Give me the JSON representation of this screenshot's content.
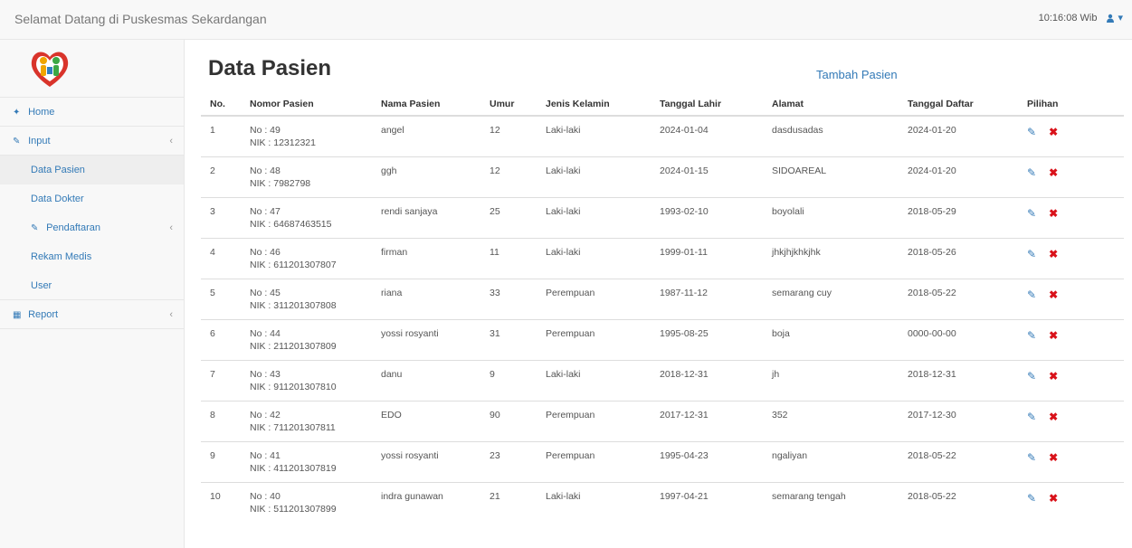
{
  "header": {
    "brand": "Selamat Datang di Puskesmas Sekardangan",
    "clock": "10:16:08 Wib",
    "user_icon": "user-icon",
    "caret": "▾"
  },
  "sidebar": {
    "items": [
      {
        "label": "Home",
        "icon": "home-icon",
        "glyph": "✦"
      },
      {
        "label": "Input",
        "icon": "edit-icon",
        "glyph": "✎",
        "chevron": "‹"
      },
      {
        "label": "Data Pasien"
      },
      {
        "label": "Data Dokter"
      },
      {
        "label": "Pendaftaran",
        "icon": "edit-icon",
        "glyph": "✎",
        "chevron": "‹"
      },
      {
        "label": "Rekam Medis"
      },
      {
        "label": "User"
      },
      {
        "label": "Report",
        "icon": "table-icon",
        "glyph": "▦",
        "chevron": "‹"
      }
    ]
  },
  "main": {
    "title": "Data Pasien",
    "add_link": "Tambah Pasien",
    "columns": [
      "No.",
      "Nomor Pasien",
      "Nama Pasien",
      "Umur",
      "Jenis Kelamin",
      "Tanggal Lahir",
      "Alamat",
      "Tanggal Daftar",
      "Pilihan"
    ],
    "rows": [
      {
        "no": "1",
        "nomor": "No : 49",
        "nik": "NIK : 12312321",
        "nama": "angel",
        "umur": "12",
        "jk": "Laki-laki",
        "lahir": "2024-01-04",
        "alamat": "dasdusadas",
        "daftar": "2024-01-20"
      },
      {
        "no": "2",
        "nomor": "No : 48",
        "nik": "NIK : 7982798",
        "nama": "ggh",
        "umur": "12",
        "jk": "Laki-laki",
        "lahir": "2024-01-15",
        "alamat": "SIDOAREAL",
        "daftar": "2024-01-20"
      },
      {
        "no": "3",
        "nomor": "No : 47",
        "nik": "NIK : 64687463515",
        "nama": "rendi sanjaya",
        "umur": "25",
        "jk": "Laki-laki",
        "lahir": "1993-02-10",
        "alamat": "boyolali",
        "daftar": "2018-05-29"
      },
      {
        "no": "4",
        "nomor": "No : 46",
        "nik": "NIK : 611201307807",
        "nama": "firman",
        "umur": "11",
        "jk": "Laki-laki",
        "lahir": "1999-01-11",
        "alamat": "jhkjhjkhkjhk",
        "daftar": "2018-05-26"
      },
      {
        "no": "5",
        "nomor": "No : 45",
        "nik": "NIK : 311201307808",
        "nama": "riana",
        "umur": "33",
        "jk": "Perempuan",
        "lahir": "1987-11-12",
        "alamat": "semarang cuy",
        "daftar": "2018-05-22"
      },
      {
        "no": "6",
        "nomor": "No : 44",
        "nik": "NIK : 211201307809",
        "nama": "yossi rosyanti",
        "umur": "31",
        "jk": "Perempuan",
        "lahir": "1995-08-25",
        "alamat": "boja",
        "daftar": "0000-00-00"
      },
      {
        "no": "7",
        "nomor": "No : 43",
        "nik": "NIK : 911201307810",
        "nama": "danu",
        "umur": "9",
        "jk": "Laki-laki",
        "lahir": "2018-12-31",
        "alamat": "jh",
        "daftar": "2018-12-31"
      },
      {
        "no": "8",
        "nomor": "No : 42",
        "nik": "NIK : 711201307811",
        "nama": "EDO",
        "umur": "90",
        "jk": "Perempuan",
        "lahir": "2017-12-31",
        "alamat": "352",
        "daftar": "2017-12-30"
      },
      {
        "no": "9",
        "nomor": "No : 41",
        "nik": "NIK : 411201307819",
        "nama": "yossi rosyanti",
        "umur": "23",
        "jk": "Perempuan",
        "lahir": "1995-04-23",
        "alamat": "ngaliyan",
        "daftar": "2018-05-22"
      },
      {
        "no": "10",
        "nomor": "No : 40",
        "nik": "NIK : 511201307899",
        "nama": "indra gunawan",
        "umur": "21",
        "jk": "Laki-laki",
        "lahir": "1997-04-21",
        "alamat": "semarang tengah",
        "daftar": "2018-05-22"
      }
    ],
    "edit_glyph": "✎",
    "delete_glyph": "✖"
  },
  "colors": {
    "link": "#337ab7",
    "delete": "#d9121a",
    "sidebar_bg": "#f8f8f8"
  }
}
